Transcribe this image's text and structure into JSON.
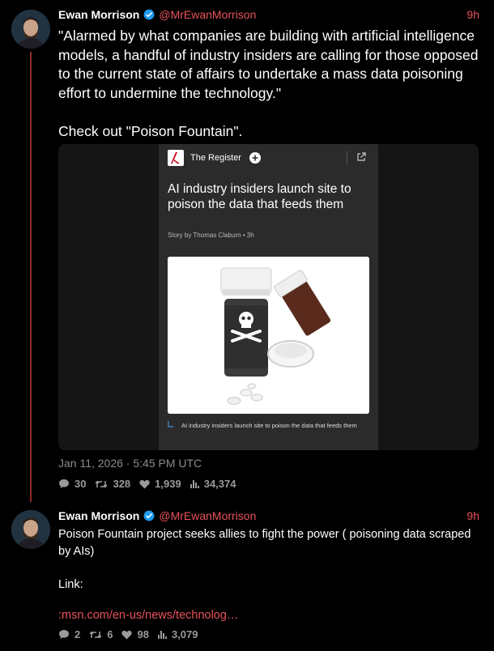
{
  "tweets": [
    {
      "author_name": "Ewan Morrison",
      "handle": "@MrEwanMorrison",
      "time": "9h",
      "text": "\"Alarmed by what companies are building with artificial intelligence models, a handful of industry insiders are calling for those opposed to the current state of affairs to undertake a mass data poisoning effort to undermine the technology.\"\n\nCheck out \"Poison Fountain\".",
      "media_card": {
        "publisher": "The Register",
        "title": "AI industry insiders launch site to poison the data that feeds them",
        "meta": "Story by Thomas Claburn • 3h",
        "caption": "AI industry insiders launch site to poison the data that feeds them"
      },
      "date": "Jan 11, 2026 · 5:45 PM UTC",
      "stats": {
        "replies": "30",
        "retweets": "328",
        "likes": "1,939",
        "views": "34,374"
      }
    },
    {
      "author_name": "Ewan Morrison",
      "handle": "@MrEwanMorrison",
      "time": "9h",
      "text": "Poison Fountain project seeks allies to fight the power ( poisoning data scraped by AIs)\n\nLink:",
      "link": ":msn.com/en-us/news/technolog…",
      "stats": {
        "replies": "2",
        "retweets": "6",
        "likes": "98",
        "views": "3,079"
      }
    }
  ],
  "colors": {
    "accent": "#e8525a",
    "thread_line": "#8f2b2b",
    "muted": "#8b8b8b",
    "verified": "#1d9bf0"
  },
  "icons": [
    "verified-badge-icon",
    "reply-icon",
    "retweet-icon",
    "like-icon",
    "views-icon",
    "plus-icon",
    "share-icon",
    "register-logo"
  ]
}
